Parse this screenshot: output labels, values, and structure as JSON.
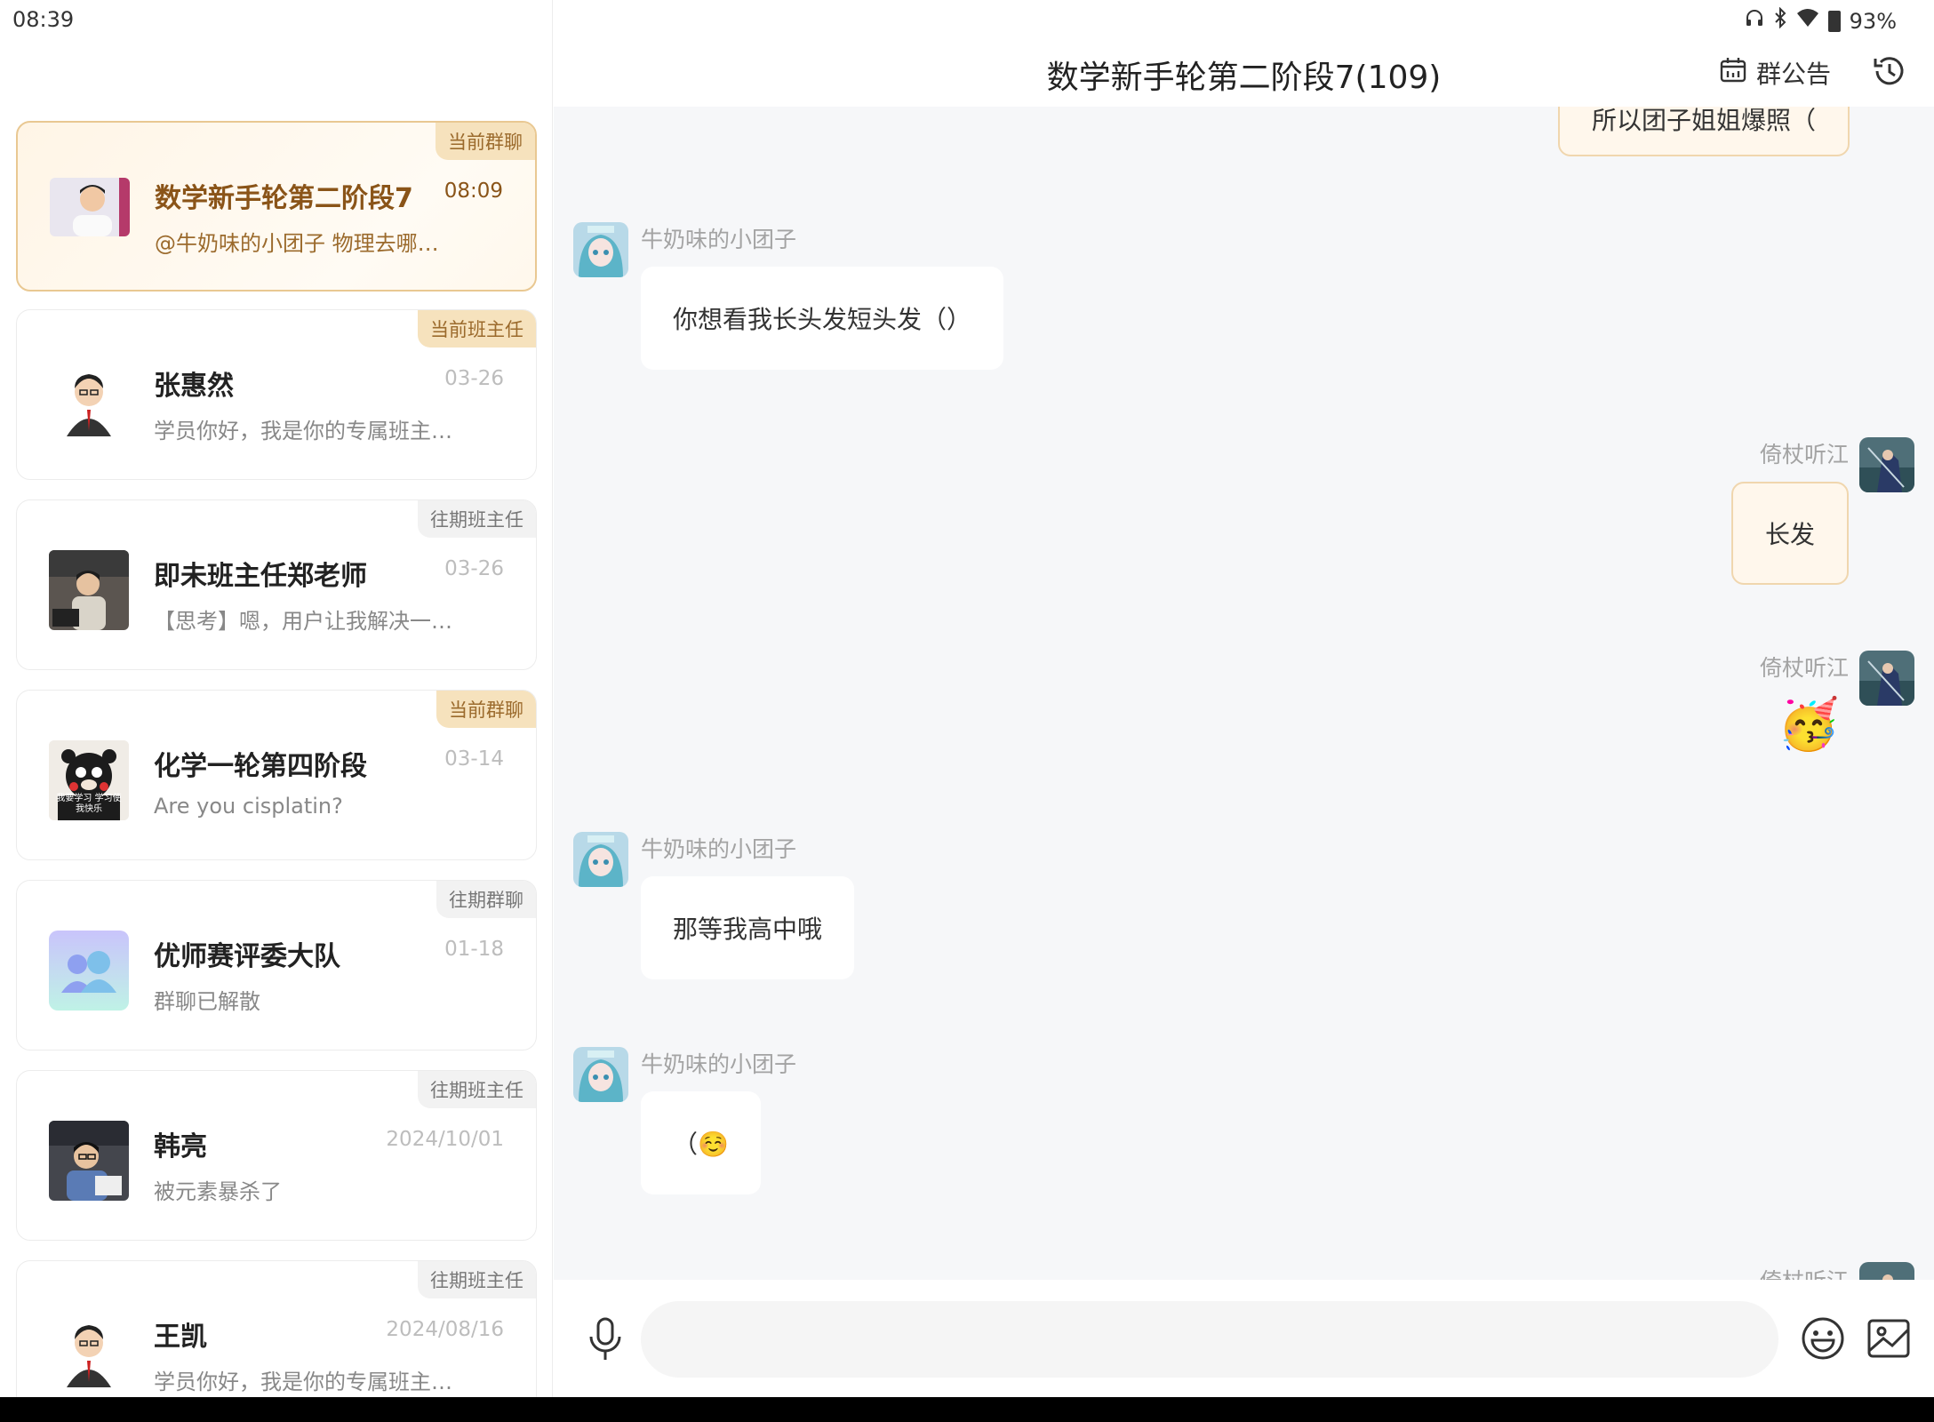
{
  "status_bar": {
    "time": "08:39",
    "battery": "93%"
  },
  "conversations": [
    {
      "name": "数学新手轮第二阶段7",
      "time": "08:09",
      "preview": "@牛奶味的小团子 物理去哪…",
      "tag": "当前群聊",
      "active": true
    },
    {
      "name": "张惠然",
      "time": "03-26",
      "preview": "学员你好，我是你的专属班主…",
      "tag": "当前班主任"
    },
    {
      "name": "即未班主任郑老师",
      "time": "03-26",
      "preview": "【思考】嗯，用户让我解决一…",
      "tag": "往期班主任"
    },
    {
      "name": "化学一轮第四阶段",
      "time": "03-14",
      "preview": "Are you cisplatin?",
      "tag": "当前群聊",
      "avatar_caption": "我要学习 学习使我快乐"
    },
    {
      "name": "优师赛评委大队",
      "time": "01-18",
      "preview": "群聊已解散",
      "tag": "往期群聊"
    },
    {
      "name": "韩亮",
      "time": "2024/10/01",
      "preview": "被元素暴杀了",
      "tag": "往期班主任"
    },
    {
      "name": "王凯",
      "time": "2024/08/16",
      "preview": "学员你好，我是你的专属班主…",
      "tag": "往期班主任"
    }
  ],
  "chat": {
    "title": "数学新手轮第二阶段7(109)",
    "notice_label": "群公告",
    "messages": [
      {
        "side": "right",
        "text": "所以团子姐姐爆照（"
      },
      {
        "side": "left",
        "sender": "牛奶味的小团子",
        "text": "你想看我长头发短头发（）"
      },
      {
        "side": "right",
        "sender": "倚杖听江",
        "text": "长发"
      },
      {
        "side": "right",
        "sender": "倚杖听江",
        "emoji": "🥳"
      },
      {
        "side": "left",
        "sender": "牛奶味的小团子",
        "text": "那等我高中哦"
      },
      {
        "side": "left",
        "sender": "牛奶味的小团子",
        "text": "（☺️"
      },
      {
        "side": "right",
        "sender": "倚杖听江"
      }
    ]
  },
  "input": {
    "placeholder": ""
  },
  "icons": {
    "headphones": "headphones-icon",
    "bluetooth": "bluetooth-icon",
    "wifi": "wifi-icon",
    "battery": "battery-icon",
    "calendar": "calendar-icon",
    "history": "history-icon",
    "mic": "microphone-icon",
    "emoji": "emoji-icon",
    "image": "image-icon"
  },
  "colors": {
    "accent_gold": "#e9c892",
    "active_text": "#8a5418",
    "tag_gold_bg": "#f6e2bd"
  }
}
